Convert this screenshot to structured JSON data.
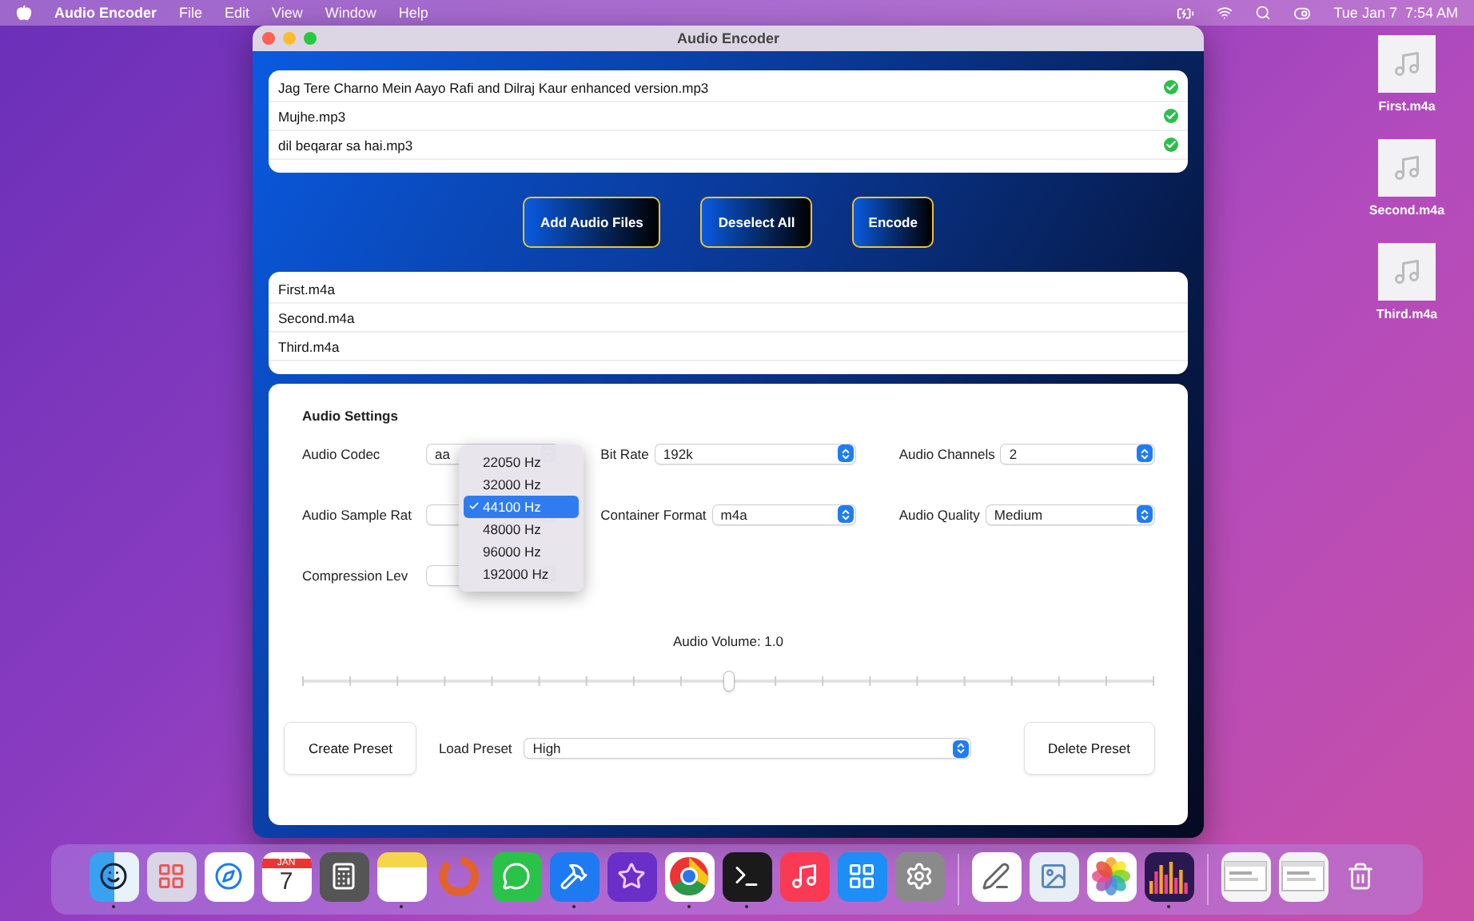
{
  "menu_bar": {
    "app_name": "Audio Encoder",
    "menus": [
      "File",
      "Edit",
      "View",
      "Window",
      "Help"
    ],
    "date": "Tue Jan 7",
    "time": "7:54 AM"
  },
  "window": {
    "title": "Audio Encoder",
    "source_files": [
      {
        "name": "Jag Tere Charno Mein Aayo Rafi and Dilraj Kaur enhanced version.mp3",
        "done": true
      },
      {
        "name": "Mujhe.mp3",
        "done": true
      },
      {
        "name": "dil beqarar sa hai.mp3",
        "done": true
      }
    ],
    "buttons": [
      "Add Audio Files",
      "Deselect All",
      "Encode"
    ],
    "output_files": [
      "First.m4a",
      "Second.m4a",
      "Third.m4a"
    ],
    "settings": {
      "title": "Audio Settings",
      "fields": [
        {
          "label": "Audio Codec",
          "value": "aa"
        },
        {
          "label": "Bit Rate",
          "value": "192k"
        },
        {
          "label": "Audio Channels",
          "value": "2"
        },
        {
          "label": "Audio Sample Rat",
          "kind": "popup"
        },
        {
          "label": "Container Format",
          "value": "m4a"
        },
        {
          "label": "Audio Quality",
          "value": "Medium"
        },
        {
          "label": "Compression Lev"
        }
      ],
      "sample_rate_menu": [
        {
          "label": "22050 Hz",
          "selected": false
        },
        {
          "label": "32000 Hz",
          "selected": false
        },
        {
          "label": "44100 Hz",
          "selected": true
        },
        {
          "label": "48000 Hz",
          "selected": false
        },
        {
          "label": "96000 Hz",
          "selected": false
        },
        {
          "label": "192000 Hz",
          "selected": false
        }
      ],
      "volume": {
        "label": "Audio Volume: 1.0",
        "level": 0.5
      },
      "create_preset": "Create Preset",
      "load_preset": {
        "label": "Load Preset",
        "value": "High"
      },
      "delete_preset": "Delete Preset"
    }
  },
  "desktop_files": [
    "First.m4a",
    "Second.m4a",
    "Third.m4a"
  ],
  "dock": [
    {
      "kind": "finder",
      "running": true
    },
    {
      "kind": "launchpad",
      "running": false
    },
    {
      "kind": "safari",
      "running": false
    },
    {
      "kind": "calendar",
      "running": false,
      "month": "JAN",
      "day": "7"
    },
    {
      "kind": "calculator",
      "running": false
    },
    {
      "kind": "notes",
      "running": true
    },
    {
      "kind": "ring",
      "running": false
    },
    {
      "kind": "chat",
      "running": false
    },
    {
      "kind": "hammer",
      "running": true
    },
    {
      "kind": "star",
      "running": false
    },
    {
      "kind": "chrome",
      "running": true
    },
    {
      "kind": "terminal",
      "running": true
    },
    {
      "kind": "music",
      "running": false
    },
    {
      "kind": "appstore",
      "running": false
    },
    {
      "kind": "settings",
      "running": false
    },
    {
      "kind": "separator"
    },
    {
      "kind": "textedit",
      "running": false
    },
    {
      "kind": "preview",
      "running": false
    },
    {
      "kind": "photos",
      "running": false
    },
    {
      "kind": "equalizer",
      "running": true
    },
    {
      "kind": "separator"
    },
    {
      "kind": "window",
      "running": false
    },
    {
      "kind": "window",
      "running": false
    },
    {
      "kind": "trash",
      "running": false
    }
  ]
}
